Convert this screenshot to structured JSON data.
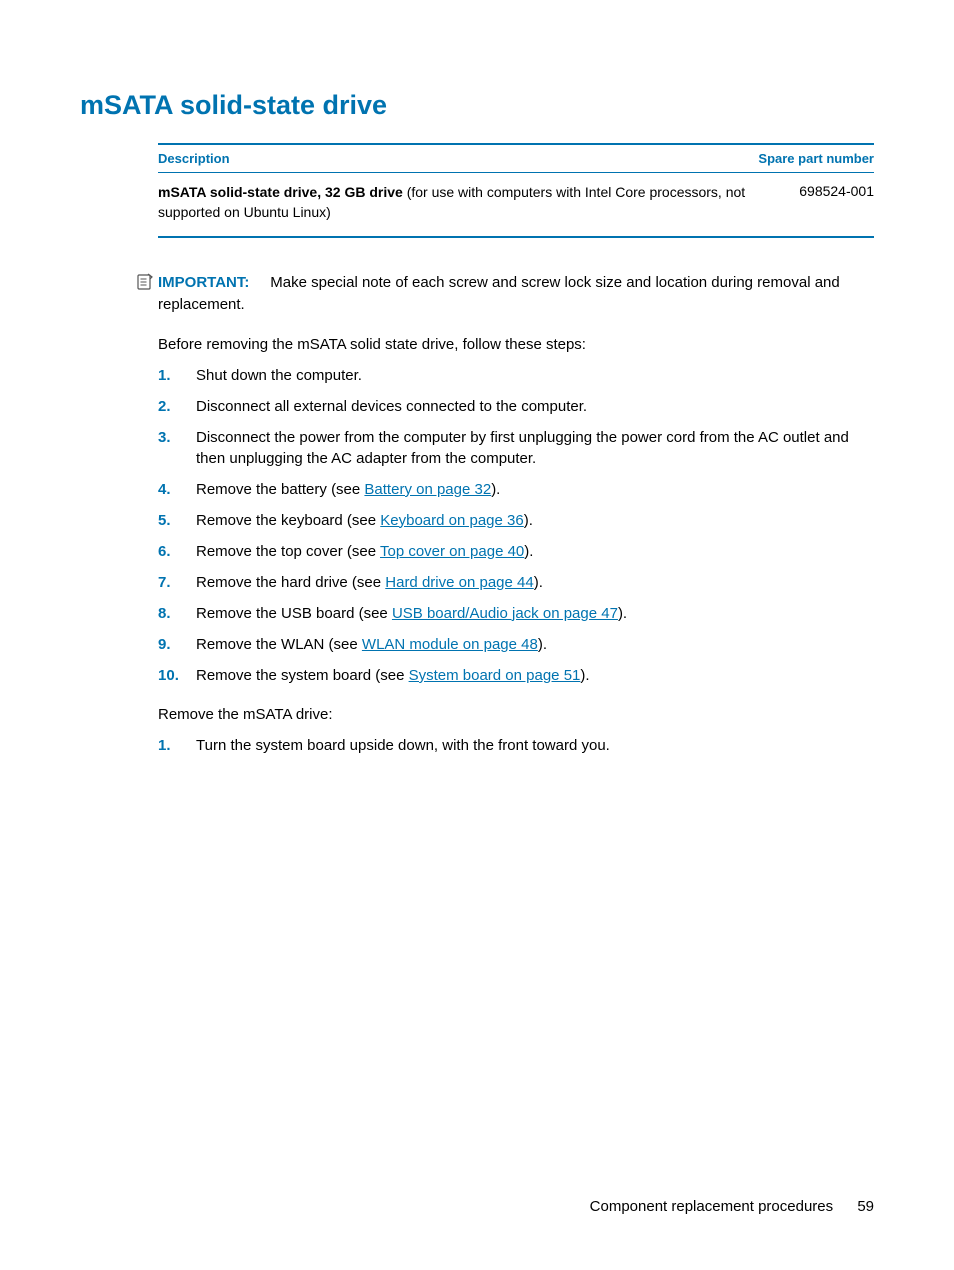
{
  "heading": "mSATA solid-state drive",
  "table": {
    "headers": {
      "description": "Description",
      "spare": "Spare part number"
    },
    "row": {
      "desc_bold": "mSATA solid-state drive, 32 GB drive",
      "desc_rest": " (for use with computers with Intel Core processors, not supported on Ubuntu Linux)",
      "spare": "698524-001"
    }
  },
  "important": {
    "label": "IMPORTANT:",
    "text": "Make special note of each screw and screw lock size and location during removal and replacement."
  },
  "intro1": "Before removing the mSATA solid state drive, follow these steps:",
  "steps1": [
    {
      "pre": "Shut down the computer.",
      "link": "",
      "post": ""
    },
    {
      "pre": "Disconnect all external devices connected to the computer.",
      "link": "",
      "post": ""
    },
    {
      "pre": "Disconnect the power from the computer by first unplugging the power cord from the AC outlet and then unplugging the AC adapter from the computer.",
      "link": "",
      "post": ""
    },
    {
      "pre": "Remove the battery (see ",
      "link": "Battery on page 32",
      "post": ")."
    },
    {
      "pre": "Remove the keyboard (see ",
      "link": "Keyboard on page 36",
      "post": ")."
    },
    {
      "pre": "Remove the top cover (see ",
      "link": "Top cover on page 40",
      "post": ")."
    },
    {
      "pre": "Remove the hard drive (see ",
      "link": "Hard drive on page 44",
      "post": ")."
    },
    {
      "pre": "Remove the USB board (see ",
      "link": "USB board/Audio jack on page 47",
      "post": ")."
    },
    {
      "pre": "Remove the WLAN (see ",
      "link": "WLAN module on page 48",
      "post": ")."
    },
    {
      "pre": "Remove the system board (see ",
      "link": "System board on page 51",
      "post": ")."
    }
  ],
  "intro2": "Remove the mSATA drive:",
  "steps2": [
    {
      "pre": "Turn the system board upside down, with the front toward you.",
      "link": "",
      "post": ""
    }
  ],
  "footer": {
    "section": "Component replacement procedures",
    "page": "59"
  }
}
